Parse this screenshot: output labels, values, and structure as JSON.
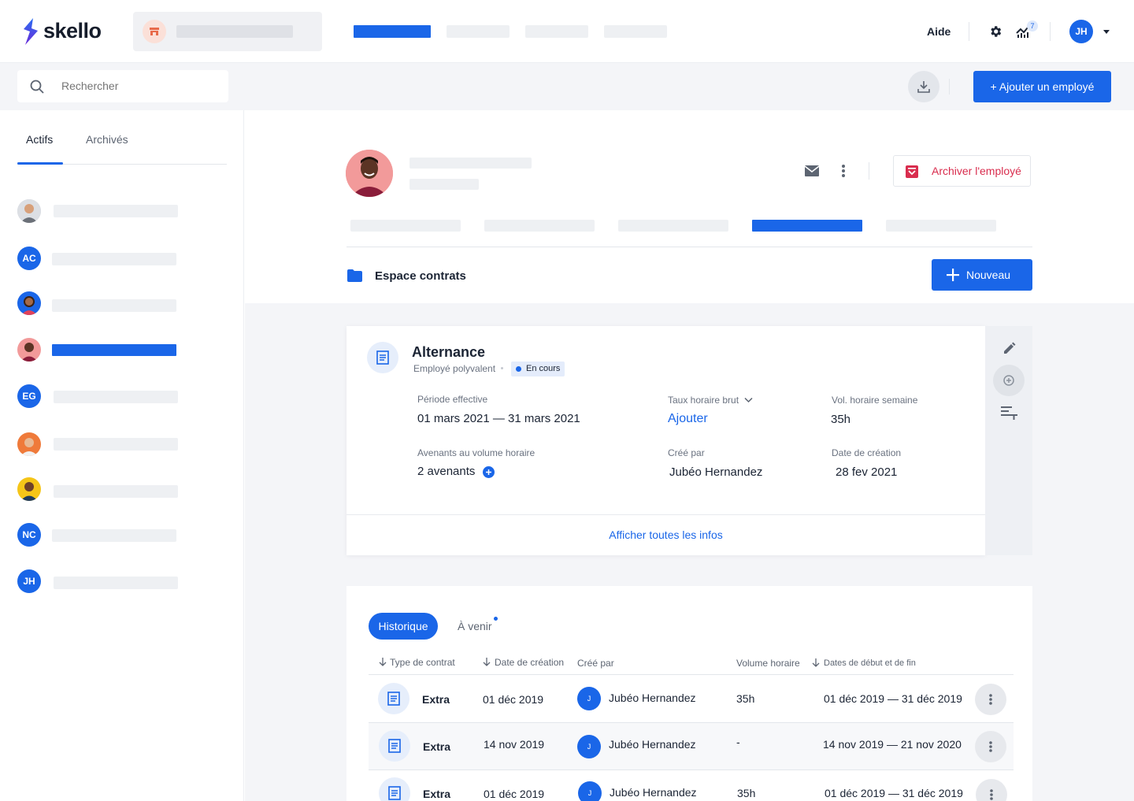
{
  "app": {
    "brand": "skello"
  },
  "topbar": {
    "help": "Aide",
    "notif_count": "7",
    "user_initials": "JH"
  },
  "subbar": {
    "search_placeholder": "Rechercher",
    "add_employee": "+ Ajouter un employé"
  },
  "sidebar": {
    "tabs": [
      {
        "label": "Actifs",
        "active": true
      },
      {
        "label": "Archivés",
        "active": false
      }
    ],
    "employees": [
      {
        "kind": "photo"
      },
      {
        "kind": "initials",
        "initials": "AC"
      },
      {
        "kind": "photo"
      },
      {
        "kind": "photo",
        "selected": true
      },
      {
        "kind": "initials",
        "initials": "EG"
      },
      {
        "kind": "photo"
      },
      {
        "kind": "photo"
      },
      {
        "kind": "initials",
        "initials": "NC"
      },
      {
        "kind": "initials",
        "initials": "JH"
      }
    ]
  },
  "profile": {
    "archive": "Archiver l'employé"
  },
  "contracts": {
    "section_title": "Espace contrats",
    "new_button": "Nouveau",
    "current": {
      "title": "Alternance",
      "subtitle": "Employé polyvalent",
      "status": "En cours",
      "period_label": "Période effective",
      "period_value": "01 mars 2021 — 31 mars 2021",
      "rate_label": "Taux horaire brut",
      "rate_value": "Ajouter",
      "weekly_label": "Vol. horaire semaine",
      "weekly_value": "35h",
      "amend_label": "Avenants au volume horaire",
      "amend_value": "2 avenants",
      "created_by_label": "Créé par",
      "created_by_value": "Jubéo Hernandez",
      "created_date_label": "Date de création",
      "created_date_value": "28 fev 2021",
      "show_all": "Afficher toutes les infos"
    },
    "history": {
      "tab_history": "Historique",
      "tab_upcoming": "À venir",
      "headers": {
        "type": "Type de contrat",
        "created": "Date de création",
        "by": "Créé par",
        "volume": "Volume horaire",
        "dates": "Dates de début et de fin"
      },
      "rows": [
        {
          "type": "Extra",
          "created": "01 déc 2019",
          "by_initial": "J",
          "by": "Jubéo Hernandez",
          "volume": "35h",
          "dates": "01 déc 2019 — 31 déc 2019"
        },
        {
          "type": "Extra",
          "created": "14 nov 2019",
          "by_initial": "J",
          "by": "Jubéo Hernandez",
          "volume": "-",
          "dates": "14 nov 2019 — 21 nov 2020"
        },
        {
          "type": "Extra",
          "created": "01 déc 2019",
          "by_initial": "J",
          "by": "Jubéo Hernandez",
          "volume": "35h",
          "dates": "01 déc 2019 — 31 déc 2019"
        }
      ]
    }
  }
}
